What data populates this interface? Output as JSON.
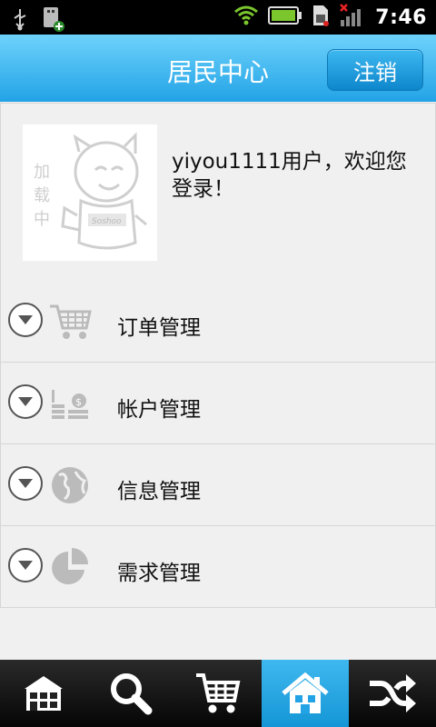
{
  "status_bar": {
    "time": "7:46",
    "icons": [
      "usb-icon",
      "usb-debug-icon",
      "wifi-icon",
      "battery-icon",
      "sim-icon",
      "signal-icon"
    ]
  },
  "header": {
    "title": "居民中心",
    "logout_label": "注销"
  },
  "profile": {
    "avatar_placeholder": "加载中",
    "welcome_text": "yiyou1111用户，欢迎您登录！"
  },
  "menu": {
    "items": [
      {
        "label": "订单管理",
        "icon": "cart-icon"
      },
      {
        "label": "帐户管理",
        "icon": "coins-icon"
      },
      {
        "label": "信息管理",
        "icon": "globe-icon"
      },
      {
        "label": "需求管理",
        "icon": "pie-chart-icon"
      }
    ]
  },
  "tabbar": {
    "tabs": [
      {
        "icon": "store-icon",
        "active": false
      },
      {
        "icon": "search-icon",
        "active": false
      },
      {
        "icon": "cart-icon",
        "active": false
      },
      {
        "icon": "home-icon",
        "active": true
      },
      {
        "icon": "shuffle-icon",
        "active": false
      }
    ],
    "active_color": "#29aae6"
  }
}
